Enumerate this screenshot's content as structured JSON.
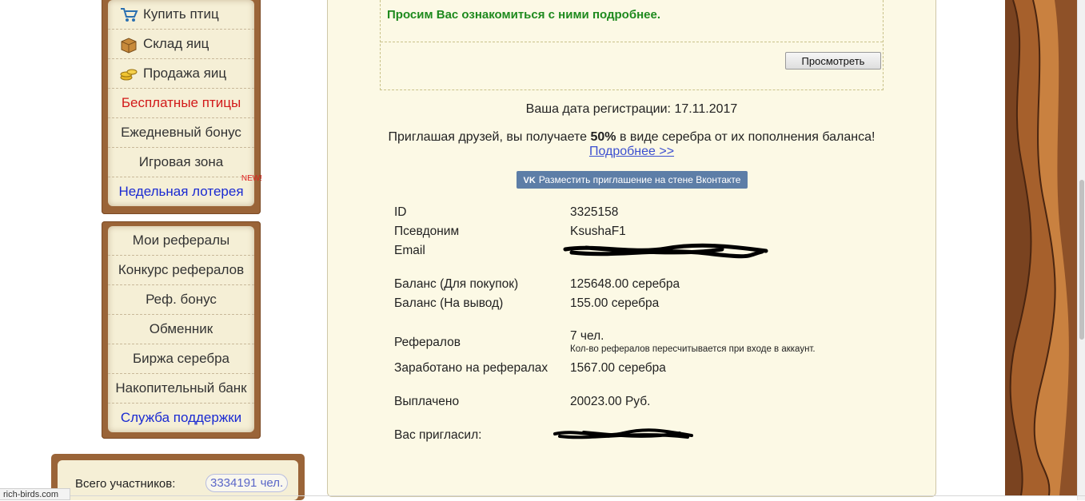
{
  "sidebar": {
    "menu1": [
      {
        "label": "Купить птиц",
        "icon": "cart-icon"
      },
      {
        "label": "Склад яиц",
        "icon": "box-icon"
      },
      {
        "label": "Продажа яиц",
        "icon": "coins-icon"
      },
      {
        "label": "Бесплатные птицы",
        "style": "red"
      },
      {
        "label": "Ежедневный бонус"
      },
      {
        "label": "Игровая зона"
      },
      {
        "label": "Недельная лотерея",
        "style": "blue",
        "badge": "NEW!"
      }
    ],
    "menu2": [
      {
        "label": "Мои рефералы"
      },
      {
        "label": "Конкурс рефералов"
      },
      {
        "label": "Реф. бонус"
      },
      {
        "label": "Обменник"
      },
      {
        "label": "Биржа серебра"
      },
      {
        "label": "Накопительный банк"
      },
      {
        "label": "Служба поддержки",
        "style": "blue"
      }
    ],
    "stats": {
      "label": "Всего участников:",
      "value": "3334191 чел."
    }
  },
  "notice": {
    "text": "Просим Вас ознакомиться с ними подробнее.",
    "button_label": "Просмотреть"
  },
  "registration": {
    "label": "Ваша дата регистрации:",
    "date": "17.11.2017"
  },
  "invite": {
    "prefix": "Приглашая друзей, вы получаете",
    "percent": "50%",
    "suffix": "в виде серебра от их пополнения баланса!",
    "more_link": "Подробнее >>",
    "vk_button": "Разместить приглашение на стене Вконтакте",
    "vk_logo": "VK"
  },
  "profile": {
    "id_label": "ID",
    "id_value": "3325158",
    "nick_label": "Псевдоним",
    "nick_value": "KsushaF1",
    "email_label": "Email",
    "balance_buy_label": "Баланс (Для покупок)",
    "balance_buy_value": "125648.00 серебра",
    "balance_out_label": "Баланс (На вывод)",
    "balance_out_value": "155.00 серебра",
    "referrals_label": "Рефералов",
    "referrals_value": "7 чел.",
    "referrals_note": "Кол-во рефералов пересчитывается при входе в аккаунт.",
    "earned_label": "Заработано на рефералах",
    "earned_value": "1567.00 серебра",
    "paid_label": "Выплачено",
    "paid_value": "20023.00 Руб.",
    "invited_by_label": "Вас пригласил:"
  },
  "status_bar": {
    "url": "rich-birds.com"
  },
  "colors": {
    "accent_green": "#1e8a1e",
    "link_blue": "#3b4fd0",
    "vk_blue": "#5d7ea7",
    "wood_brown": "#9a6438"
  }
}
